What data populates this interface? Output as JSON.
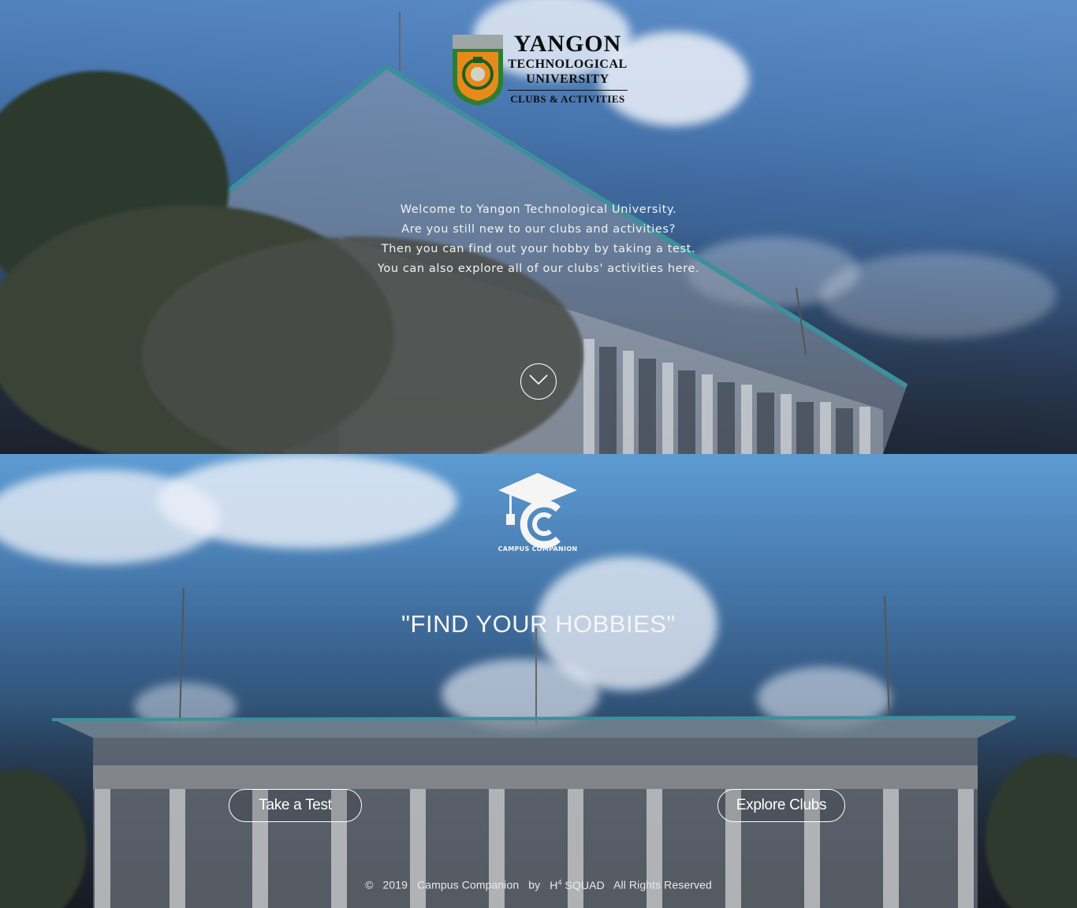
{
  "hero": {
    "logo": {
      "title_line1": "YANGON",
      "title_line2": "TECHNOLOGICAL",
      "title_line3": "UNIVERSITY",
      "subtitle": "CLUBS & ACTIVITIES"
    },
    "welcome_lines": [
      "Welcome to Yangon Technological University.",
      "Are you still new to our clubs and activities?",
      "Then you can find out your hobby by taking a test.",
      "You can also explore all of our clubs' activities here."
    ],
    "scroll_icon": "chevron-down-icon"
  },
  "hobbies": {
    "brand_label": "CAMPUS COMPANION",
    "tagline": "\"FIND YOUR HOBBIES\"",
    "buttons": {
      "take_test": "Take a Test",
      "explore_clubs": "Explore Clubs"
    }
  },
  "footer": {
    "copyright_symbol": "©",
    "year": "2019",
    "product": "Campus Companion",
    "by": "by",
    "team_prefix": "H",
    "team_sup": "4",
    "team_suffix": "SQUAD",
    "rights": "All Rights Reserved"
  },
  "colors": {
    "crest_orange": "#e88a1a",
    "crest_green": "#2e7d32",
    "sky_blue": "#4e86bd",
    "roof_teal": "#3d8f9c"
  }
}
